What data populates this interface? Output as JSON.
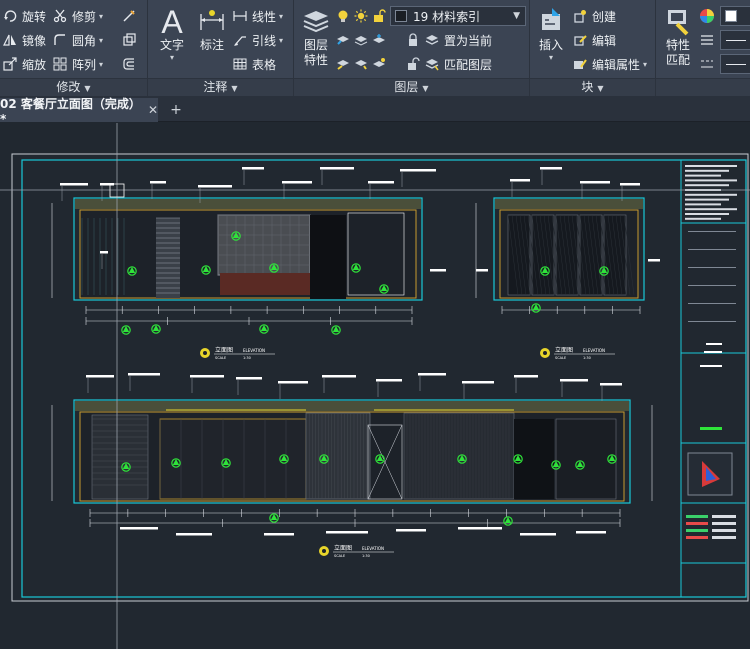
{
  "ribbon": {
    "modify": {
      "title": "修改",
      "rotate": "旋转",
      "trim": "修剪",
      "mirror": "镜像",
      "fillet": "圆角",
      "scale": "缩放",
      "array": "阵列"
    },
    "annotation": {
      "title": "注释",
      "text": "文字",
      "dimension": "标注",
      "linear": "线性",
      "leader": "引线",
      "table": "表格"
    },
    "layers": {
      "title": "图层",
      "properties_line1": "图层",
      "properties_line2": "特性",
      "current_layer": "19 材料索引",
      "set_current": "置为当前",
      "match_layer": "匹配图层"
    },
    "block": {
      "title": "块",
      "insert": "插入",
      "create": "创建",
      "edit": "编辑",
      "edit_attributes": "编辑属性"
    },
    "properties": {
      "match_line1": "特性",
      "match_line2": "匹配"
    }
  },
  "tabs": {
    "active_label": "02 客餐厅立面图（完成）*",
    "close_glyph": "✕",
    "new_tab_glyph": "+"
  },
  "drawing": {
    "elevation_label": "立面图",
    "elevation_sub": "ELEVATION",
    "scale_label": "SCALE",
    "scale_value": "1:30"
  },
  "colors": {
    "ribbon_bg": "#3b4453",
    "drawing_bg": "#212830",
    "frame_cyan": "#19c8d8",
    "marker_green": "#2fe43a",
    "accent_yellow": "#e8d52a"
  }
}
